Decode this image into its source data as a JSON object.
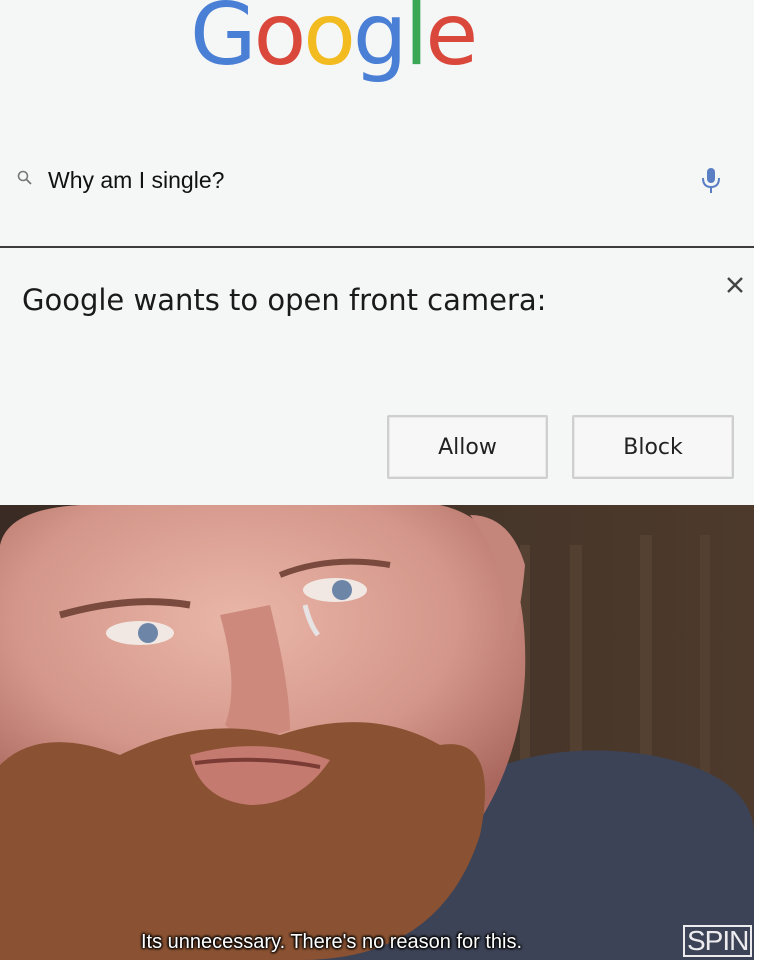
{
  "google_logo": {
    "letters": [
      {
        "char": "G",
        "color": "#4a7fd6"
      },
      {
        "char": "o",
        "color": "#d9483b"
      },
      {
        "char": "o",
        "color": "#f2bb1f"
      },
      {
        "char": "g",
        "color": "#4a7fd6"
      },
      {
        "char": "l",
        "color": "#3aa757"
      },
      {
        "char": "e",
        "color": "#d9483b"
      }
    ]
  },
  "search": {
    "query": "Why am I single?",
    "icon": "search-icon",
    "mic_icon": "microphone-icon",
    "mic_color": "#5b7fc4"
  },
  "permission_prompt": {
    "message": "Google wants to open front camera:",
    "close_icon": "close-icon",
    "allow_label": "Allow",
    "block_label": "Block"
  },
  "photo": {
    "subtitle": "Its unnecessary. There's no reason for this.",
    "watermark": "SPIN"
  }
}
